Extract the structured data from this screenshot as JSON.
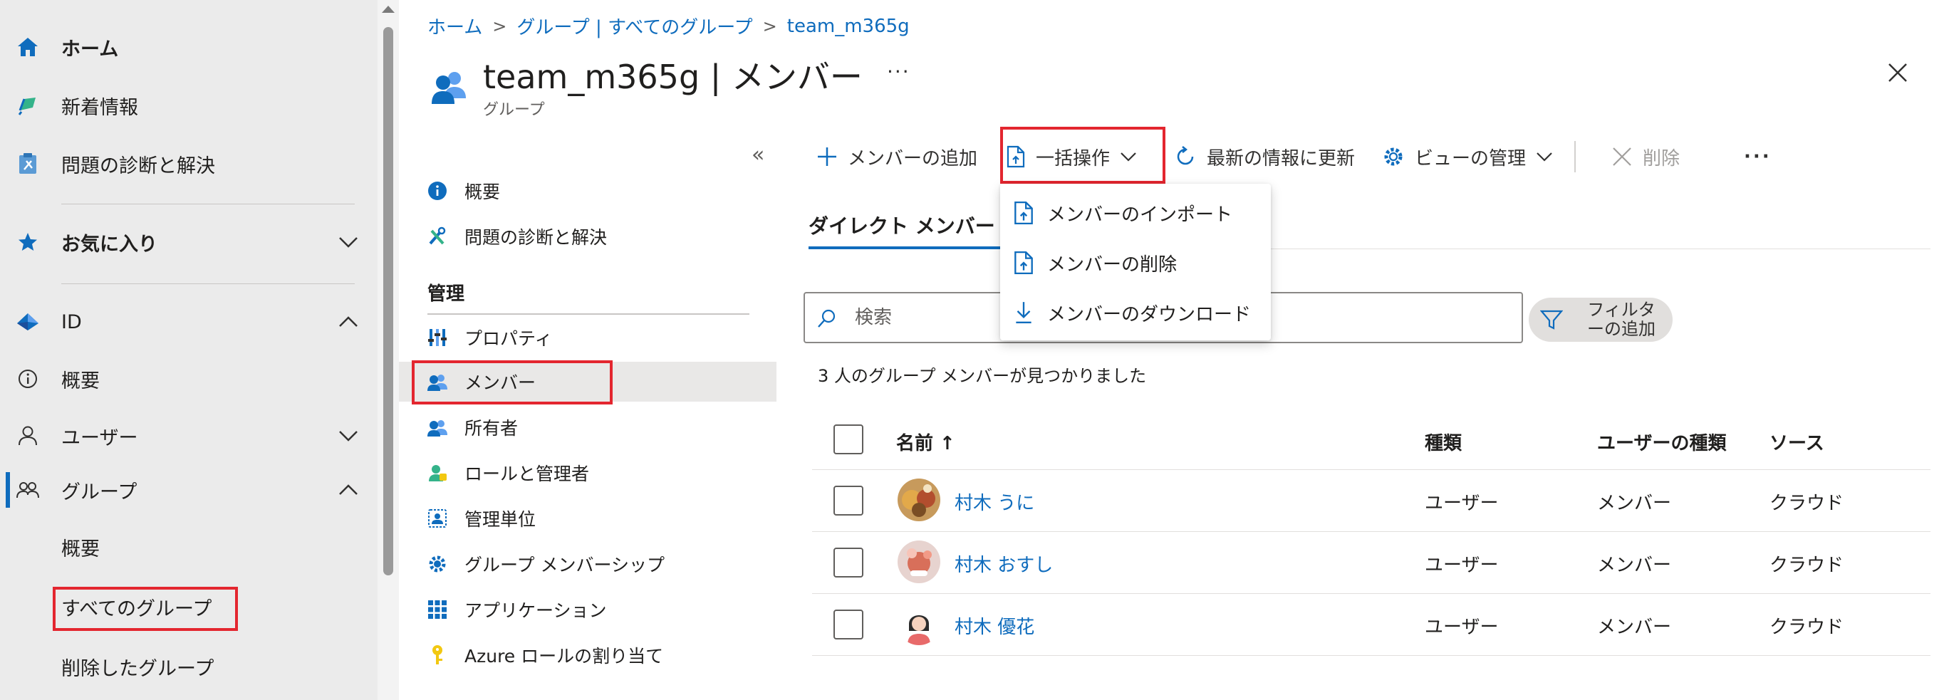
{
  "leftnav": {
    "home": "ホーム",
    "whats_new": "新着情報",
    "diagnose": "問題の診断と解決",
    "favorites": "お気に入り",
    "identity": "ID",
    "overview": "概要",
    "users": "ユーザー",
    "groups": "グループ",
    "groups_overview": "概要",
    "all_groups": "すべてのグループ",
    "deleted_groups": "削除したグループ"
  },
  "breadcrumb": {
    "home": "ホーム",
    "groups": "グループ | すべてのグループ",
    "current": "team_m365g"
  },
  "header": {
    "title": "team_m365g | メンバー",
    "subtitle": "グループ",
    "more": "···"
  },
  "menu": {
    "collapse": "«",
    "overview": "概要",
    "diagnose": "問題の診断と解決",
    "section_manage": "管理",
    "properties": "プロパティ",
    "members": "メンバー",
    "owners": "所有者",
    "roles_admins": "ロールと管理者",
    "admin_units": "管理単位",
    "group_memberships": "グループ メンバーシップ",
    "applications": "アプリケーション",
    "azure_roles": "Azure ロールの割り当て"
  },
  "toolbar": {
    "add_member": "メンバーの追加",
    "bulk_ops": "一括操作",
    "refresh": "最新の情報に更新",
    "manage_view": "ビューの管理",
    "delete": "削除",
    "more": "···"
  },
  "bulk_menu": {
    "import": "メンバーのインポート",
    "remove": "メンバーの削除",
    "download": "メンバーのダウンロード"
  },
  "tabs": {
    "direct": "ダイレクト メンバー"
  },
  "search": {
    "placeholder": "検索",
    "value": ""
  },
  "filter": {
    "label_line1": "フィルタ",
    "label_line2": "ーの追加"
  },
  "result_count": "3 人のグループ メンバーが見つかりました",
  "table": {
    "headers": {
      "name": "名前 ↑",
      "type": "種類",
      "user_type": "ユーザーの種類",
      "source": "ソース"
    },
    "rows": [
      {
        "name": "村木 うに",
        "type": "ユーザー",
        "user_type": "メンバー",
        "source": "クラウド"
      },
      {
        "name": "村木 おすし",
        "type": "ユーザー",
        "user_type": "メンバー",
        "source": "クラウド"
      },
      {
        "name": "村木 優花",
        "type": "ユーザー",
        "user_type": "メンバー",
        "source": "クラウド"
      }
    ]
  },
  "colors": {
    "accent": "#0f6cbd",
    "highlight": "#e3262f",
    "nav_bg": "#ebebeb"
  }
}
